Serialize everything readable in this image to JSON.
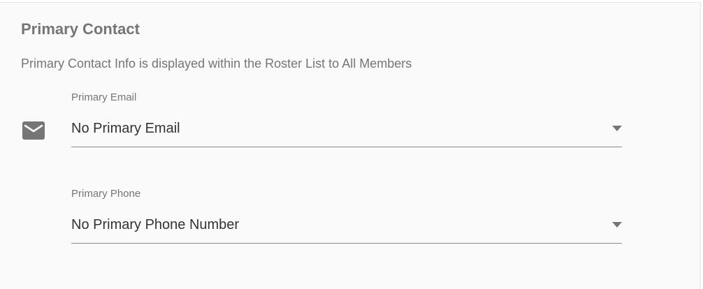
{
  "section": {
    "title": "Primary Contact",
    "description": "Primary Contact Info is displayed within the Roster List to All Members"
  },
  "email": {
    "label": "Primary Email",
    "value": "No Primary Email",
    "icon": "mail-icon"
  },
  "phone": {
    "label": "Primary Phone",
    "value": "No Primary Phone Number"
  },
  "colors": {
    "background": "#fafafa",
    "text_secondary": "#757575",
    "text_primary": "#333333",
    "icon": "#757575"
  }
}
